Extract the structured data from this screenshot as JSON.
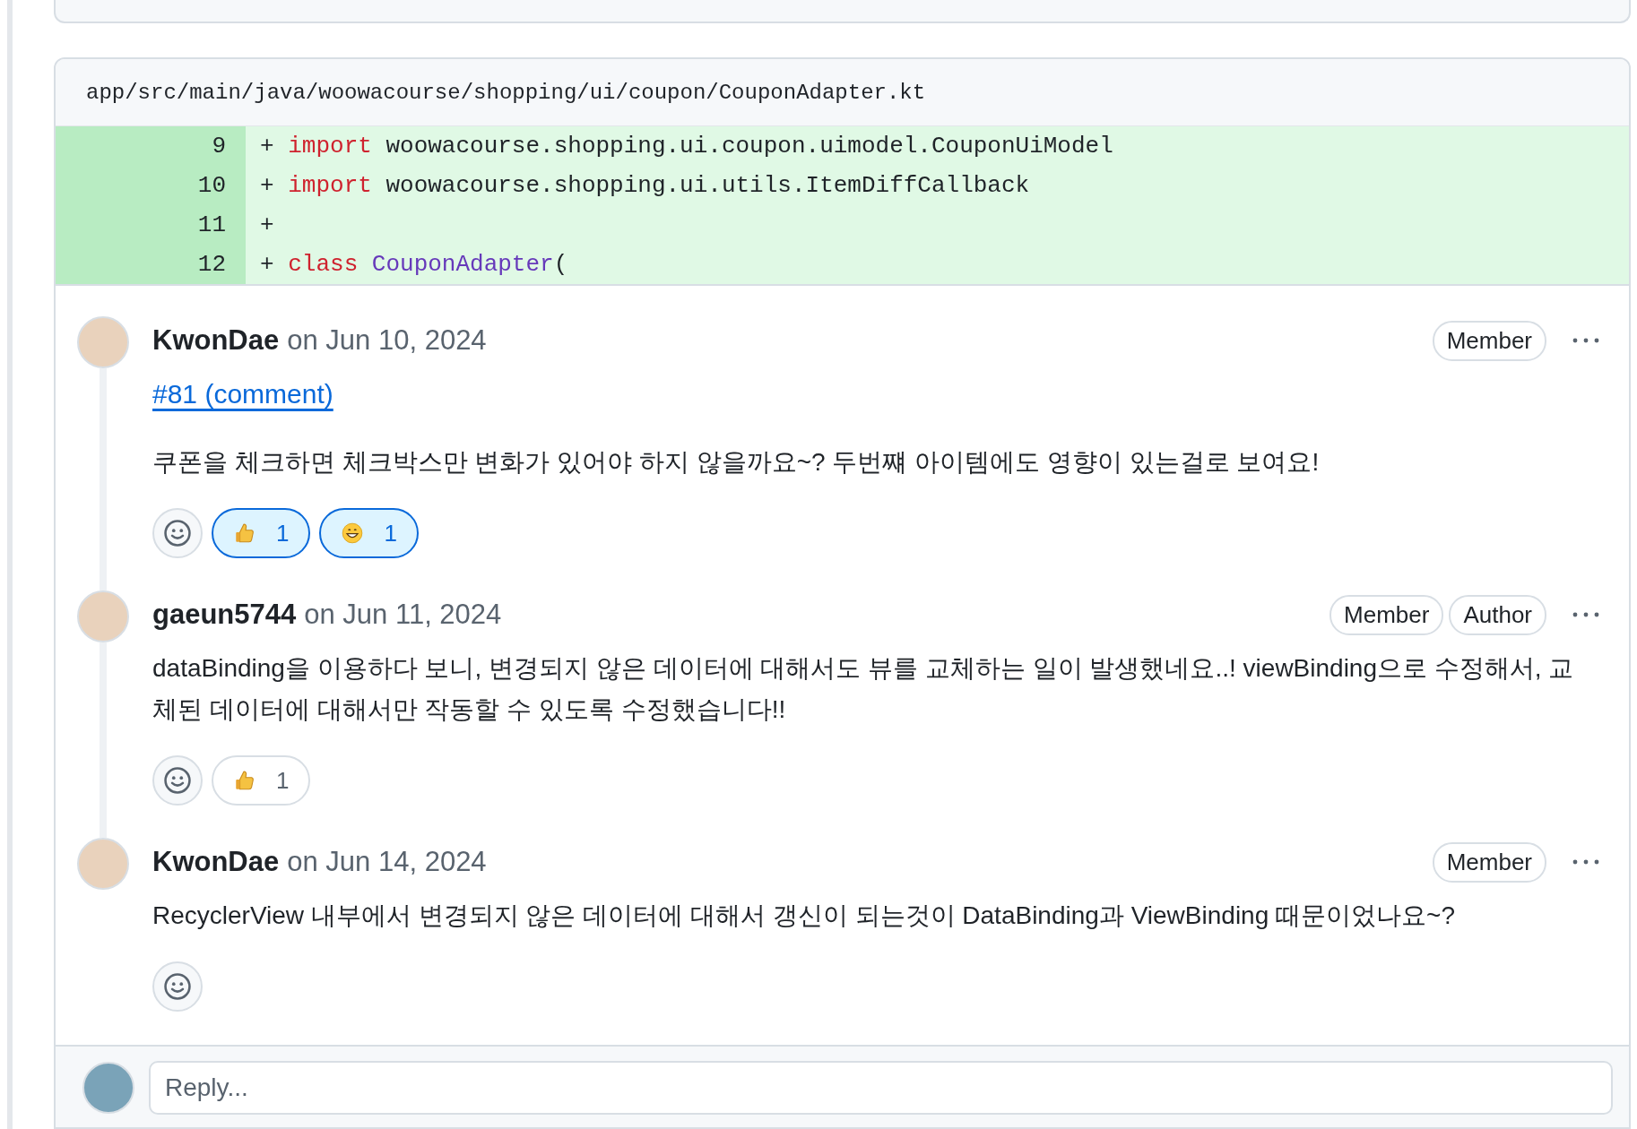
{
  "file": {
    "path": "app/src/main/java/woowacourse/shopping/ui/coupon/CouponAdapter.kt",
    "lines": [
      {
        "number": "9",
        "sign": "+",
        "tokens": [
          {
            "kind": "keyword",
            "text": "import"
          },
          {
            "kind": "plain",
            "text": " woowacourse.shopping.ui.coupon.uimodel.CouponUiModel"
          }
        ]
      },
      {
        "number": "10",
        "sign": "+",
        "tokens": [
          {
            "kind": "keyword",
            "text": "import"
          },
          {
            "kind": "plain",
            "text": " woowacourse.shopping.ui.utils.ItemDiffCallback"
          }
        ]
      },
      {
        "number": "11",
        "sign": "+"
      },
      {
        "number": "12",
        "sign": "+",
        "tokens": [
          {
            "kind": "keyword",
            "text": "class"
          },
          {
            "kind": "type",
            "text": " CouponAdapter"
          },
          {
            "kind": "plain",
            "text": "("
          }
        ]
      }
    ]
  },
  "comments": [
    {
      "author": "KwonDae",
      "date": "on Jun 10, 2024",
      "badges": [
        "Member"
      ],
      "link": "#81 (comment)",
      "body": "쿠폰을 체크하면 체크박스만 변화가 있어야 하지 않을까요~? 두번쨰 아이템에도 영향이 있는걸로 보여요!",
      "reactions": [
        {
          "kind": "thumbs_up",
          "count": "1",
          "selected": true
        },
        {
          "kind": "grin",
          "count": "1",
          "selected": true
        }
      ]
    },
    {
      "author": "gaeun5744",
      "date": "on Jun 11, 2024",
      "badges": [
        "Member",
        "Author"
      ],
      "body": "dataBinding을 이용하다 보니, 변경되지 않은 데이터에 대해서도 뷰를 교체하는 일이 발생했네요..! viewBinding으로 수정해서, 교체된 데이터에 대해서만 작동할 수 있도록 수정했습니다!!",
      "reactions": [
        {
          "kind": "thumbs_up",
          "count": "1",
          "selected": false
        }
      ]
    },
    {
      "author": "KwonDae",
      "date": "on Jun 14, 2024",
      "badges": [
        "Member"
      ],
      "body": "RecyclerView 내부에서 변경되지 않은 데이터에 대해서 갱신이 되는것이 DataBinding과 ViewBinding 때문이었나요~?"
    }
  ],
  "reply": {
    "placeholder": "Reply..."
  }
}
